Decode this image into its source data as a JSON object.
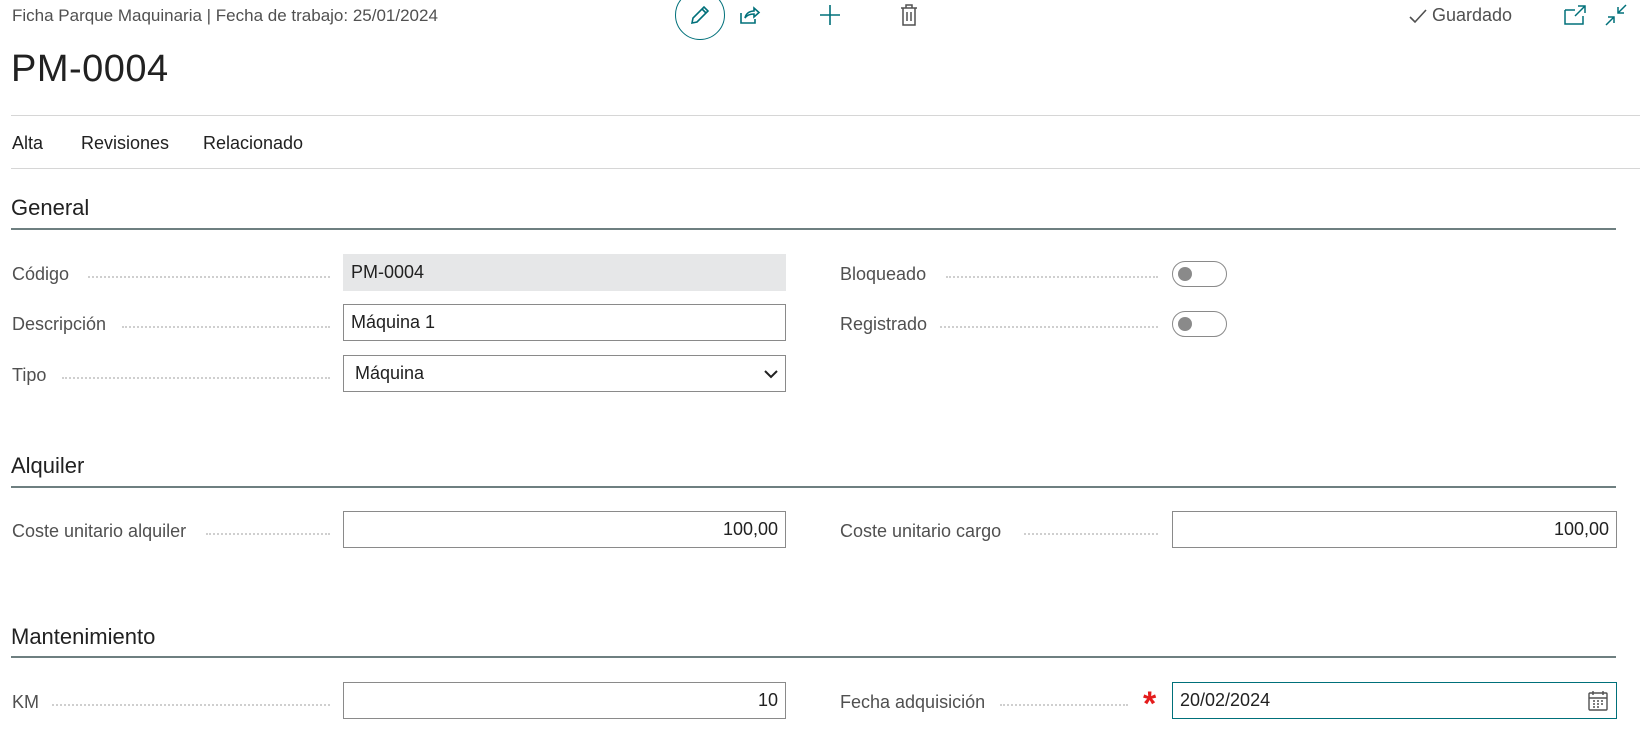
{
  "header": {
    "breadcrumb": "Ficha Parque Maquinaria | Fecha de trabajo: 25/01/2024",
    "title": "PM-0004",
    "status_label": "Guardado",
    "toolbar_icons": [
      "edit-icon",
      "share-icon",
      "plus-icon",
      "trash-icon",
      "open-new-window-icon",
      "collapse-icon"
    ]
  },
  "tabs": [
    {
      "label": "Alta"
    },
    {
      "label": "Revisiones"
    },
    {
      "label": "Relacionado"
    }
  ],
  "sections": {
    "general": {
      "title": "General",
      "codigo": {
        "label": "Código",
        "value": "PM-0004"
      },
      "descripcion": {
        "label": "Descripción",
        "value": "Máquina 1"
      },
      "tipo": {
        "label": "Tipo",
        "value": "Máquina"
      },
      "bloqueado": {
        "label": "Bloqueado",
        "value": false
      },
      "registrado": {
        "label": "Registrado",
        "value": false
      }
    },
    "alquiler": {
      "title": "Alquiler",
      "coste_alquiler": {
        "label": "Coste unitario alquiler",
        "value": "100,00"
      },
      "coste_cargo": {
        "label": "Coste unitario cargo",
        "value": "100,00"
      }
    },
    "mantenimiento": {
      "title": "Mantenimiento",
      "km": {
        "label": "KM",
        "value": "10"
      },
      "fecha_adquisicion": {
        "label": "Fecha adquisición",
        "value": "20/02/2024",
        "required_mark": "*"
      }
    }
  },
  "colors": {
    "accent": "#00707a",
    "required": "#e41c1c",
    "readonly_bg": "#e6e7e8"
  }
}
